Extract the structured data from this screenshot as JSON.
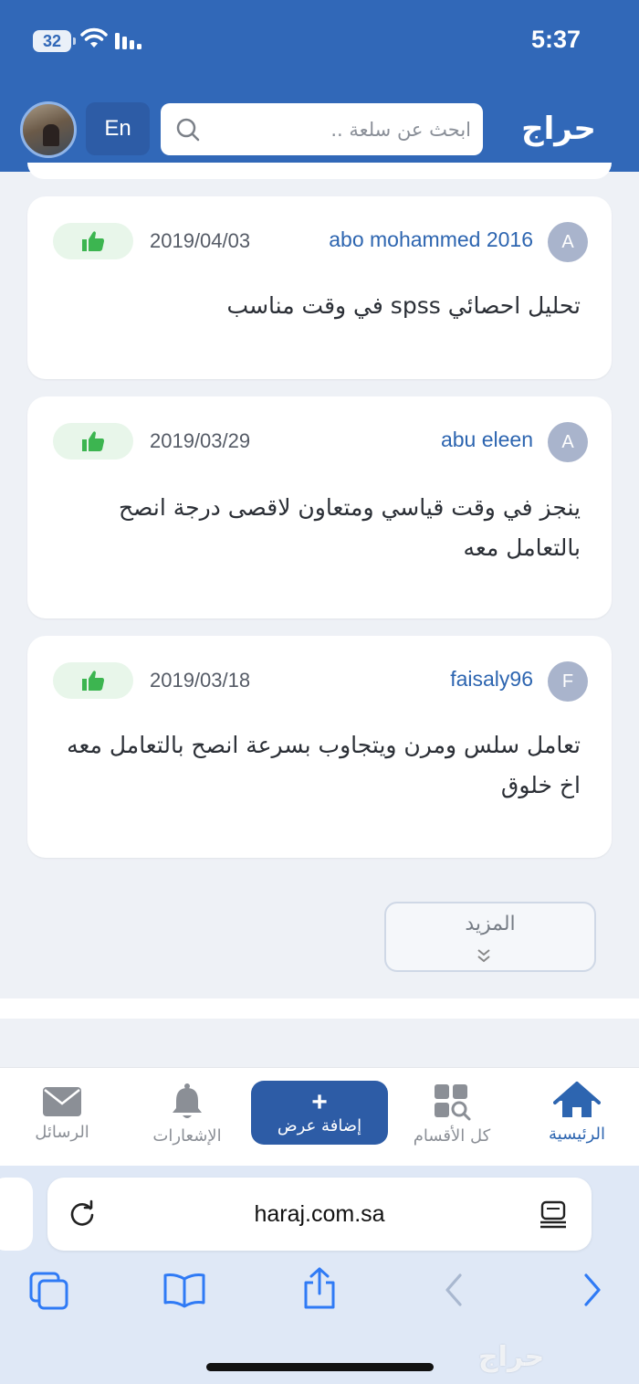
{
  "status_bar": {
    "battery": "32",
    "time": "5:37"
  },
  "header": {
    "logo_text": "حراج",
    "lang_button": "En",
    "search": {
      "placeholder": "ابحث عن سلعة ..",
      "value": ""
    }
  },
  "reviews": [
    {
      "avatar_letter": "A",
      "user": "abo mohammed 2016",
      "date": "2019/04/03",
      "text": "تحليل احصائي spss في وقت مناسب"
    },
    {
      "avatar_letter": "A",
      "user": "abu eleen",
      "date": "2019/03/29",
      "text": "ينجز في وقت قياسي ومتعاون لاقصى درجة انصح بالتعامل معه"
    },
    {
      "avatar_letter": "F",
      "user": "faisaly96",
      "date": "2019/03/18",
      "text": "تعامل سلس ومرن ويتجاوب بسرعة انصح بالتعامل معه اخ خلوق"
    }
  ],
  "more_button": {
    "label": "المزيد"
  },
  "bottom_nav": {
    "home": "الرئيسية",
    "categories": "كل الأقسام",
    "add_offer": "إضافة عرض",
    "notifications": "الإشعارات",
    "messages": "الرسائل"
  },
  "browser": {
    "url": "haraj.com.sa",
    "watermark": "حراج"
  },
  "colors": {
    "brand": "#3168b8",
    "link": "#2d65b0",
    "like_bg": "#e8f6ea",
    "like_icon": "#3cb550"
  },
  "icons": [
    "search-icon",
    "wifi-icon",
    "signal-icon",
    "thumbs-up-icon",
    "chevron-down-icon",
    "home-icon",
    "grid-search-icon",
    "bell-icon",
    "envelope-icon",
    "reload-icon",
    "reader-icon",
    "tabs-icon",
    "bookmarks-icon",
    "share-icon",
    "back-icon",
    "forward-icon"
  ]
}
